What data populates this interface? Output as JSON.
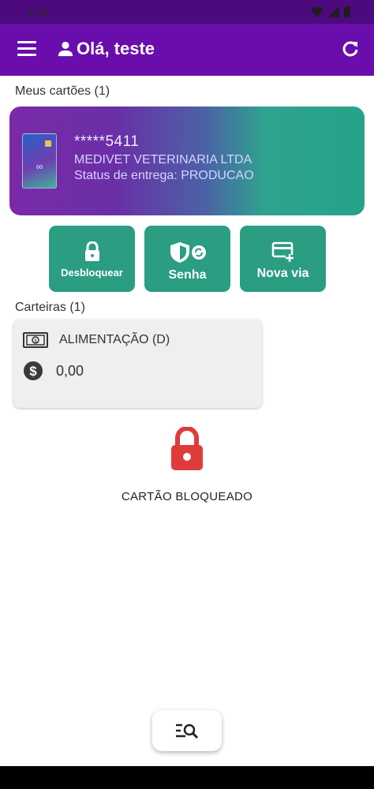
{
  "status_bar": {
    "time": "4:31"
  },
  "app_bar": {
    "title": "Olá, teste",
    "menu_icon": "menu-icon",
    "user_icon": "user-icon",
    "refresh_icon": "refresh-icon"
  },
  "cards_section": {
    "label": "Meus cartões (1)",
    "card": {
      "number": "*****5411",
      "company": "MEDIVET VETERINARIA LTDA",
      "delivery_status": "Status de entrega: PRODUCAO"
    }
  },
  "actions": [
    {
      "label": "Desbloquear",
      "icon": "lock-icon"
    },
    {
      "label": "Senha",
      "icon": "shield-refresh-icon"
    },
    {
      "label": "Nova via",
      "icon": "card-add-icon"
    }
  ],
  "wallets_section": {
    "label": "Carteiras (1)",
    "wallet": {
      "name": "ALIMENTAÇÃO (D)",
      "amount": "0,00"
    }
  },
  "blocked_status": {
    "text": "CARTÃO BLOQUEADO"
  },
  "colors": {
    "app_bar": "#6a0dad",
    "action_button": "#2a9d82",
    "lock_red": "#e03b3b"
  }
}
